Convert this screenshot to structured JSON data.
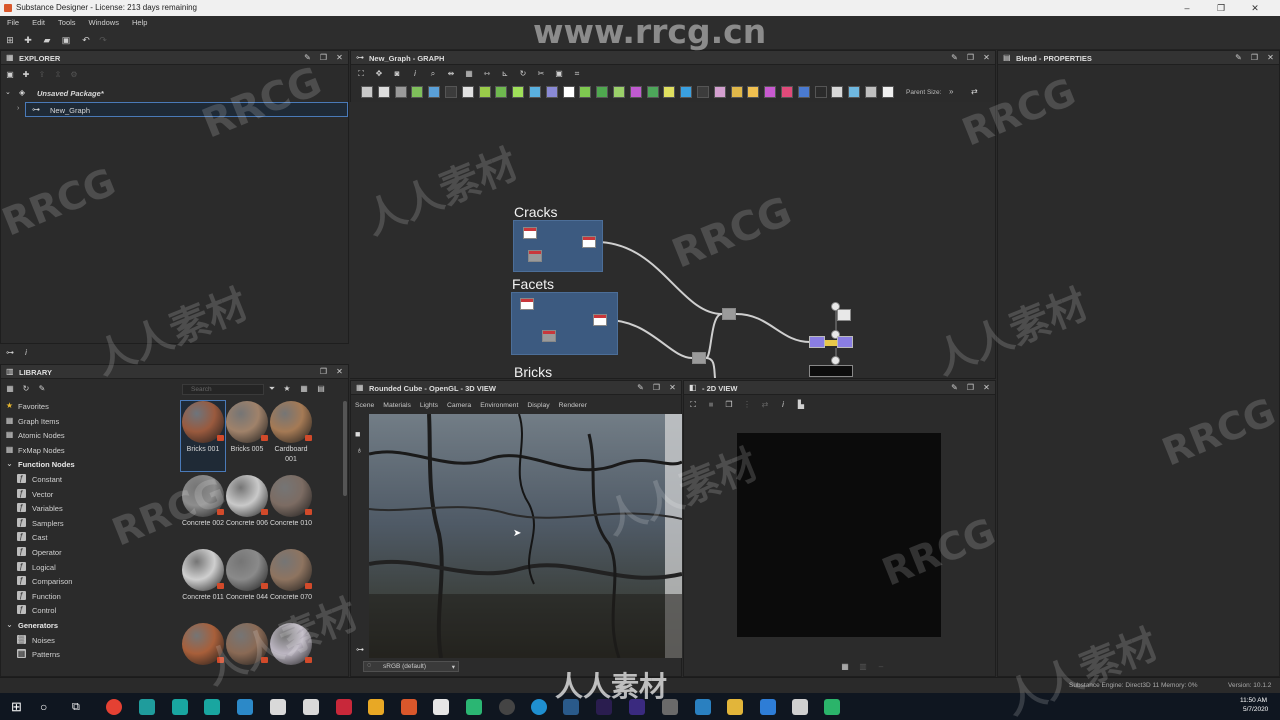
{
  "window": {
    "title": "Substance Designer - License: 213 days remaining",
    "controls": [
      "–",
      "❐",
      "✕"
    ]
  },
  "menu": [
    "File",
    "Edit",
    "Tools",
    "Windows",
    "Help"
  ],
  "explorer": {
    "title": "EXPLORER",
    "package": "Unsaved Package*",
    "graph_item": "New_Graph"
  },
  "graph": {
    "title": "New_Graph - GRAPH",
    "parent_size_label": "Parent Size:",
    "frames": [
      "Cracks",
      "Facets",
      "Bricks"
    ]
  },
  "properties": {
    "title": "Blend - PROPERTIES"
  },
  "library": {
    "title": "LIBRARY",
    "search_placeholder": "Search",
    "categories": [
      {
        "label": "Favorites",
        "type": "top",
        "icon": "star-icon"
      },
      {
        "label": "Graph Items",
        "type": "top",
        "icon": "graph-items-icon"
      },
      {
        "label": "Atomic Nodes",
        "type": "top",
        "icon": "atomic-icon"
      },
      {
        "label": "FxMap Nodes",
        "type": "top",
        "icon": "fxmap-icon"
      },
      {
        "label": "Function Nodes",
        "type": "head",
        "icon": "chevron-down-icon"
      },
      {
        "label": "Constant",
        "type": "sub",
        "icon": "function-icon"
      },
      {
        "label": "Vector",
        "type": "sub",
        "icon": "function-icon"
      },
      {
        "label": "Variables",
        "type": "sub",
        "icon": "function-icon"
      },
      {
        "label": "Samplers",
        "type": "sub",
        "icon": "function-icon"
      },
      {
        "label": "Cast",
        "type": "sub",
        "icon": "function-icon"
      },
      {
        "label": "Operator",
        "type": "sub",
        "icon": "function-icon"
      },
      {
        "label": "Logical",
        "type": "sub",
        "icon": "function-icon"
      },
      {
        "label": "Comparison",
        "type": "sub",
        "icon": "function-icon"
      },
      {
        "label": "Function",
        "type": "sub",
        "icon": "function-icon"
      },
      {
        "label": "Control",
        "type": "sub",
        "icon": "function-icon"
      },
      {
        "label": "Generators",
        "type": "head",
        "icon": "chevron-down-icon"
      },
      {
        "label": "Noises",
        "type": "sub",
        "icon": "noise-icon"
      },
      {
        "label": "Patterns",
        "type": "sub",
        "icon": "pattern-icon"
      }
    ],
    "materials": [
      {
        "name": "Bricks 001",
        "color": "#9a5a3e",
        "selected": true
      },
      {
        "name": "Bricks 005",
        "color": "#a0826a",
        "selected": false
      },
      {
        "name": "Cardboard 001",
        "color": "#a57a55",
        "selected": false
      },
      {
        "name": "Concrete 002",
        "color": "#8d8d8d",
        "selected": false
      },
      {
        "name": "Concrete 006",
        "color": "#c9c9c9",
        "selected": false
      },
      {
        "name": "Concrete 010",
        "color": "#7c6c63",
        "selected": false
      },
      {
        "name": "Concrete 011",
        "color": "#cfcfcf",
        "selected": false
      },
      {
        "name": "Concrete 044",
        "color": "#8a8a8a",
        "selected": false
      },
      {
        "name": "Concrete 070",
        "color": "#8e7460",
        "selected": false
      },
      {
        "name": "",
        "color": "#a85f3a",
        "selected": false
      },
      {
        "name": "",
        "color": "#8a6a55",
        "selected": false
      },
      {
        "name": "",
        "color": "#bcb6c2",
        "selected": false
      }
    ]
  },
  "view3d": {
    "title": "Rounded Cube - OpenGL - 3D VIEW",
    "menu": [
      "Scene",
      "Materials",
      "Lights",
      "Camera",
      "Environment",
      "Display",
      "Renderer"
    ],
    "colorspace": "sRGB (default)"
  },
  "view2d": {
    "title": "- 2D VIEW"
  },
  "status": {
    "engine": "Substance Engine: Direct3D 11  Memory: 0%",
    "version": "Version: 10.1.2"
  },
  "taskbar": {
    "time": "11:50 AM",
    "date": "5/7/2020"
  },
  "watermarks": {
    "site": "www.rrcg.cn",
    "brand": "RRCG",
    "cn": "人人素材"
  }
}
